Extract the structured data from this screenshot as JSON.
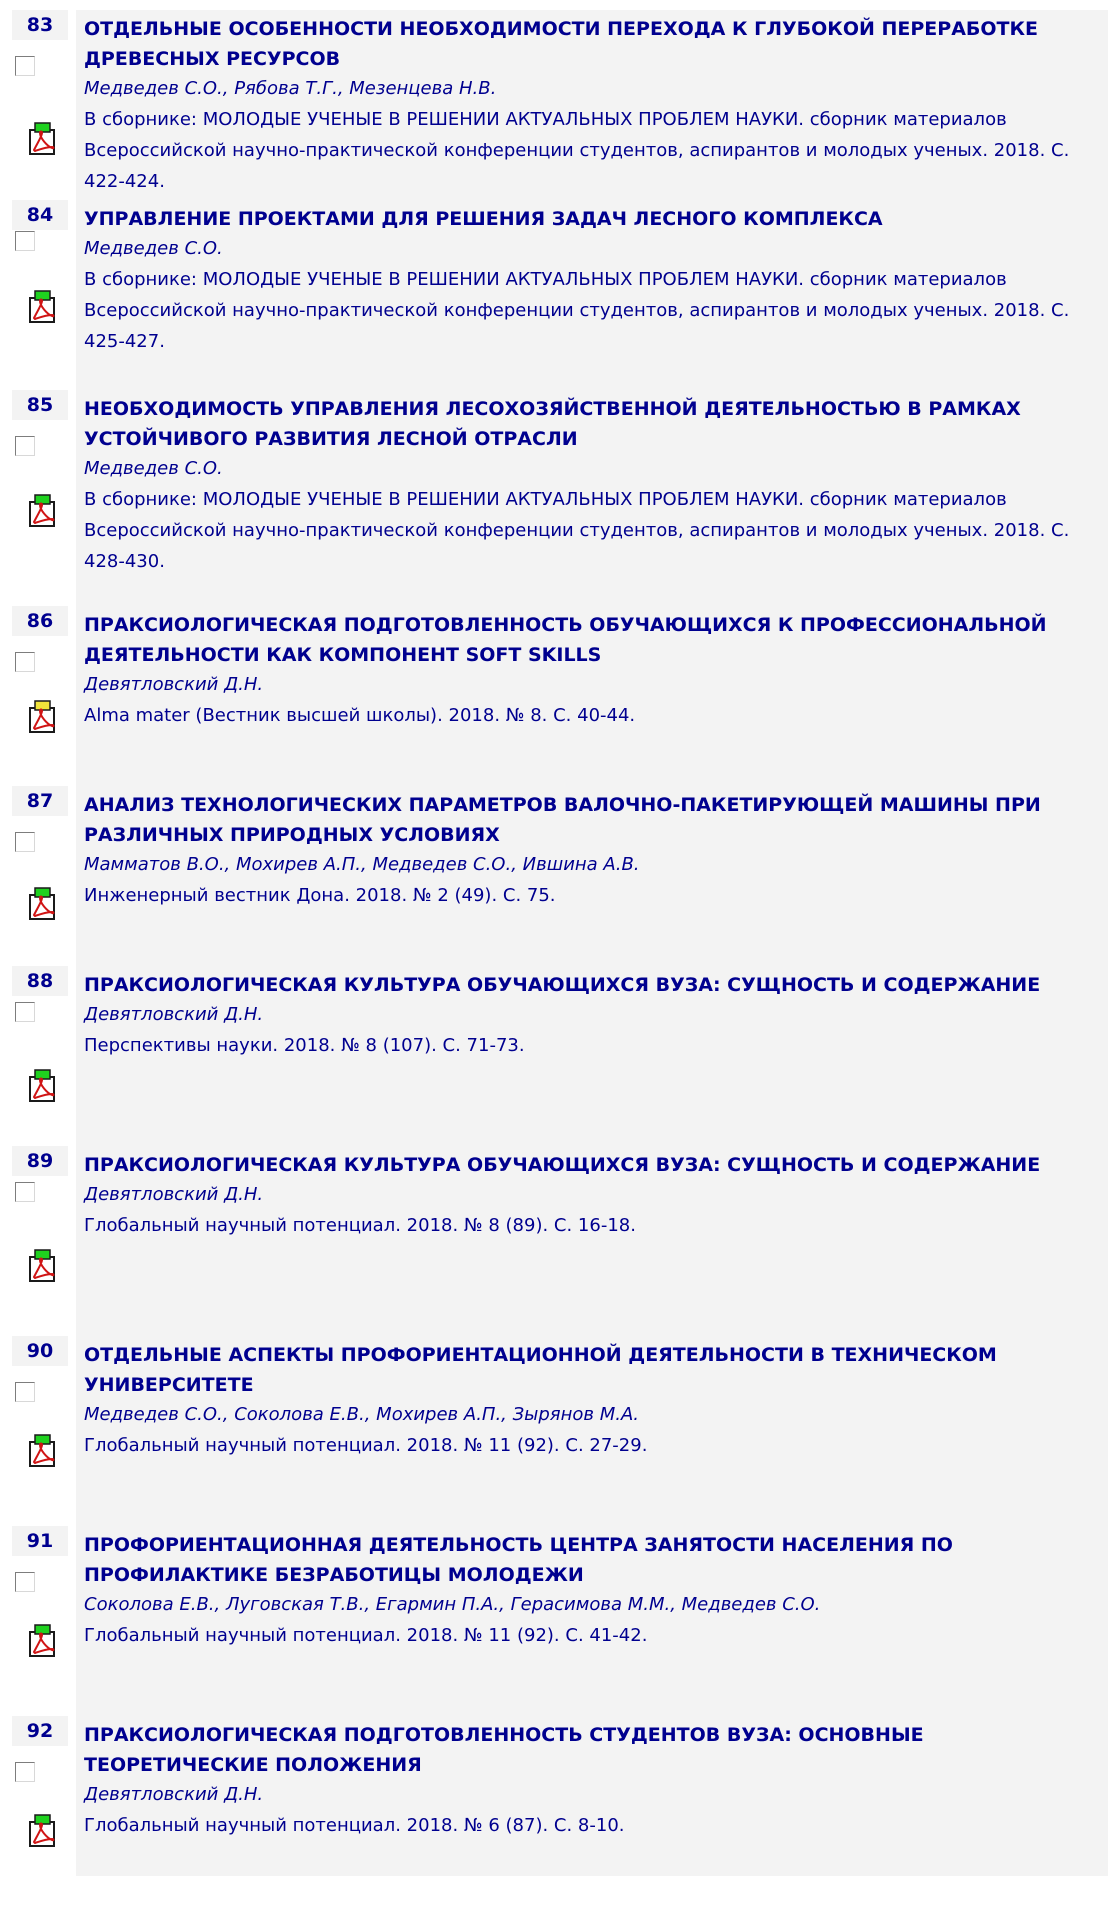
{
  "pdf_icon": "pdf-icon",
  "items": [
    {
      "num": "83",
      "title": "ОТДЕЛЬНЫЕ ОСОБЕННОСТИ НЕОБХОДИМОСТИ ПЕРЕХОДА К ГЛУБОКОЙ ПЕРЕРАБОТКЕ ДРЕВЕСНЫХ РЕСУРСОВ",
      "authors": "Медведев С.О., Рябова Т.Г., Мезенцева Н.В.",
      "source": "В сборнике: МОЛОДЫЕ УЧЕНЫЕ В РЕШЕНИИ АКТУАЛЬНЫХ ПРОБЛЕМ НАУКИ. сборник материалов Всероссийской научно-практической конференции студентов, аспирантов и молодых ученых. 2018. С. 422-424.",
      "pdf_color": "#1fd21f"
    },
    {
      "num": "84",
      "title": "УПРАВЛЕНИЕ ПРОЕКТАМИ ДЛЯ РЕШЕНИЯ ЗАДАЧ ЛЕСНОГО КОМПЛЕКСА",
      "authors": "Медведев С.О.",
      "source": "В сборнике: МОЛОДЫЕ УЧЕНЫЕ В РЕШЕНИИ АКТУАЛЬНЫХ ПРОБЛЕМ НАУКИ. сборник материалов Всероссийской научно-практической конференции студентов, аспирантов и молодых ученых. 2018. С. 425-427.",
      "pdf_color": "#1fd21f"
    },
    {
      "num": "85",
      "title": "НЕОБХОДИМОСТЬ УПРАВЛЕНИЯ ЛЕСОХОЗЯЙСТВЕННОЙ ДЕЯТЕЛЬНОСТЬЮ В РАМКАХ УСТОЙЧИВОГО РАЗВИТИЯ ЛЕСНОЙ ОТРАСЛИ",
      "authors": "Медведев С.О.",
      "source": "В сборнике: МОЛОДЫЕ УЧЕНЫЕ В РЕШЕНИИ АКТУАЛЬНЫХ ПРОБЛЕМ НАУКИ. сборник материалов Всероссийской научно-практической конференции студентов, аспирантов и молодых ученых. 2018. С. 428-430.",
      "pdf_color": "#1fd21f"
    },
    {
      "num": "86",
      "title": "ПРАКСИОЛОГИЧЕСКАЯ ПОДГОТОВЛЕННОСТЬ ОБУЧАЮЩИХСЯ К ПРОФЕССИОНАЛЬНОЙ ДЕЯТЕЛЬНОСТИ КАК КОМПОНЕНТ SOFT SKILLS",
      "authors": "Девятловский Д.Н.",
      "source": "Alma mater (Вестник высшей школы). 2018. № 8. С. 40-44.",
      "pdf_color": "#f2e43a"
    },
    {
      "num": "87",
      "title": "АНАЛИЗ ТЕХНОЛОГИЧЕСКИХ ПАРАМЕТРОВ ВАЛОЧНО-ПАКЕТИРУЮЩЕЙ МАШИНЫ ПРИ РАЗЛИЧНЫХ ПРИРОДНЫХ УСЛОВИЯХ",
      "authors": "Мамматов В.О., Мохирев А.П., Медведев С.О., Ившина А.В.",
      "source": "Инженерный вестник Дона. 2018. № 2 (49). С. 75.",
      "pdf_color": "#1fd21f"
    },
    {
      "num": "88",
      "title": "ПРАКСИОЛОГИЧЕСКАЯ КУЛЬТУРА ОБУЧАЮЩИХСЯ ВУЗА: СУЩНОСТЬ И СОДЕРЖАНИЕ",
      "authors": "Девятловский Д.Н.",
      "source": "Перспективы науки. 2018. № 8 (107). С. 71-73.",
      "pdf_color": "#1fd21f"
    },
    {
      "num": "89",
      "title": "ПРАКСИОЛОГИЧЕСКАЯ КУЛЬТУРА ОБУЧАЮЩИХСЯ ВУЗА: СУЩНОСТЬ И СОДЕРЖАНИЕ",
      "authors": "Девятловский Д.Н.",
      "source": "Глобальный научный потенциал. 2018. № 8 (89). С. 16-18.",
      "pdf_color": "#1fd21f"
    },
    {
      "num": "90",
      "title": "ОТДЕЛЬНЫЕ АСПЕКТЫ ПРОФОРИЕНТАЦИОННОЙ ДЕЯТЕЛЬНОСТИ В ТЕХНИЧЕСКОМ УНИВЕРСИТЕТЕ",
      "authors": "Медведев С.О., Соколова Е.В., Мохирев А.П., Зырянов М.А.",
      "source": "Глобальный научный потенциал. 2018. № 11 (92). С. 27-29.",
      "pdf_color": "#1fd21f"
    },
    {
      "num": "91",
      "title": "ПРОФОРИЕНТАЦИОННАЯ ДЕЯТЕЛЬНОСТЬ ЦЕНТРА ЗАНЯТОСТИ НАСЕЛЕНИЯ ПО ПРОФИЛАКТИКЕ БЕЗРАБОТИЦЫ МОЛОДЕЖИ",
      "authors": "Соколова Е.В., Луговская Т.В., Егармин П.А., Герасимова М.М., Медведев С.О.",
      "source": "Глобальный научный потенциал. 2018. № 11 (92). С. 41-42.",
      "pdf_color": "#1fd21f"
    },
    {
      "num": "92",
      "title": "ПРАКСИОЛОГИЧЕСКАЯ ПОДГОТОВЛЕННОСТЬ СТУДЕНТОВ ВУЗА: ОСНОВНЫЕ ТЕОРЕТИЧЕСКИЕ ПОЛОЖЕНИЯ",
      "authors": "Девятловский Д.Н.",
      "source": "Глобальный научный потенциал. 2018. № 6 (87). С. 8-10.",
      "pdf_color": "#1fd21f"
    }
  ]
}
